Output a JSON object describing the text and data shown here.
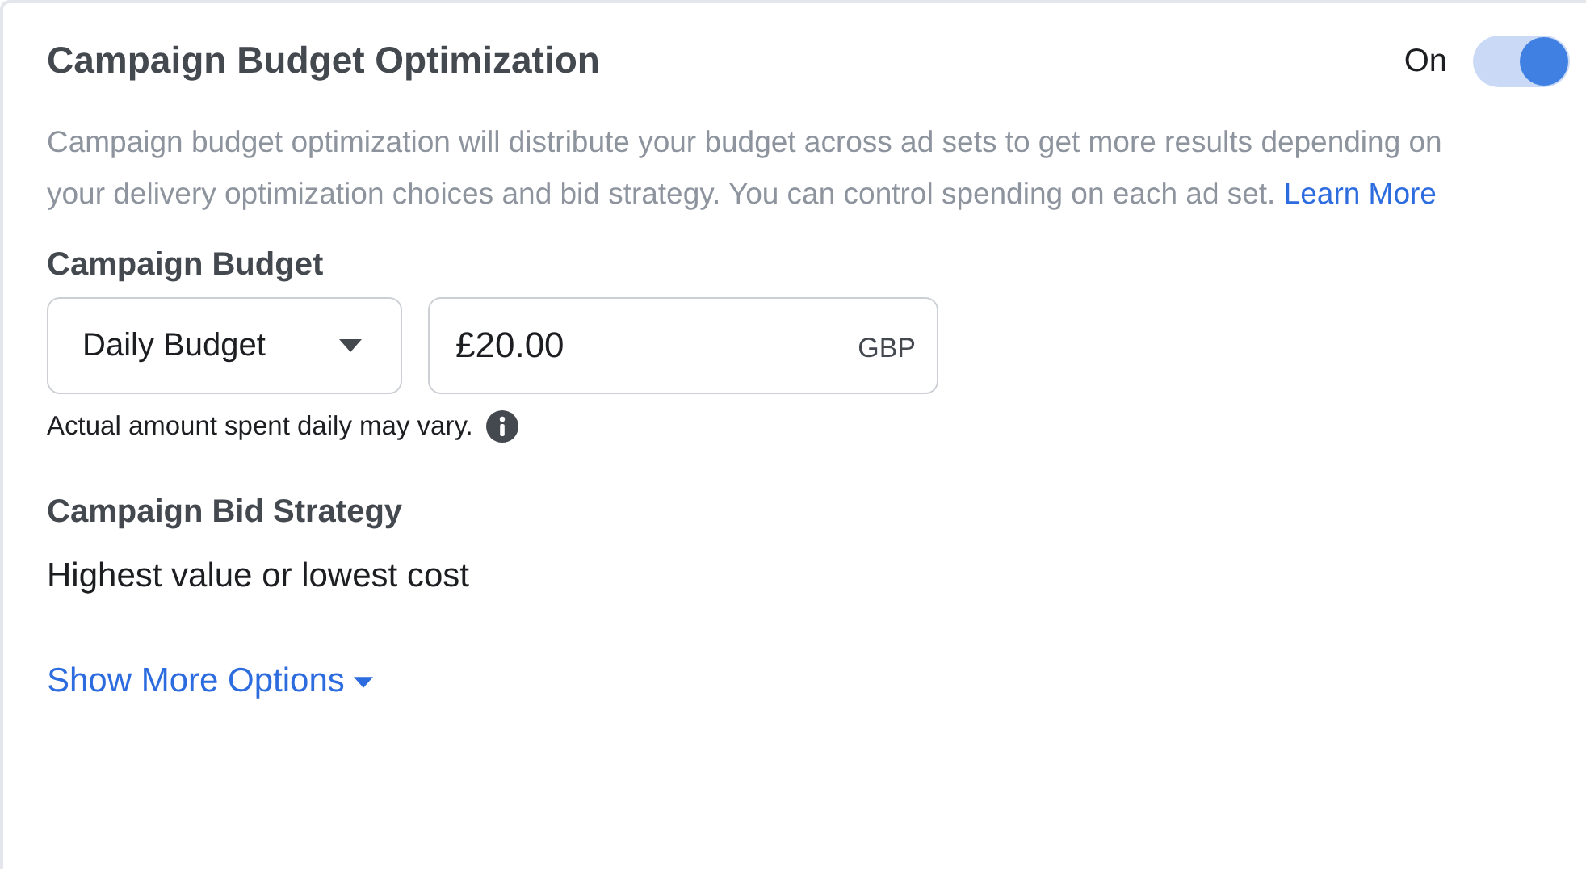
{
  "section": {
    "title": "Campaign Budget Optimization",
    "toggle": {
      "label": "On",
      "on": true
    },
    "description": "Campaign budget optimization will distribute your budget across ad sets to get more results depending on your delivery optimization choices and bid strategy. You can control spending on each ad set.",
    "learn_more_link": "Learn More"
  },
  "budget": {
    "heading": "Campaign Budget",
    "type_dropdown": "Daily Budget",
    "amount": "£20.00",
    "currency": "GBP",
    "note": "Actual amount spent daily may vary."
  },
  "bid_strategy": {
    "heading": "Campaign Bid Strategy",
    "value": "Highest value or lowest cost"
  },
  "show_more_link": "Show More Options"
}
